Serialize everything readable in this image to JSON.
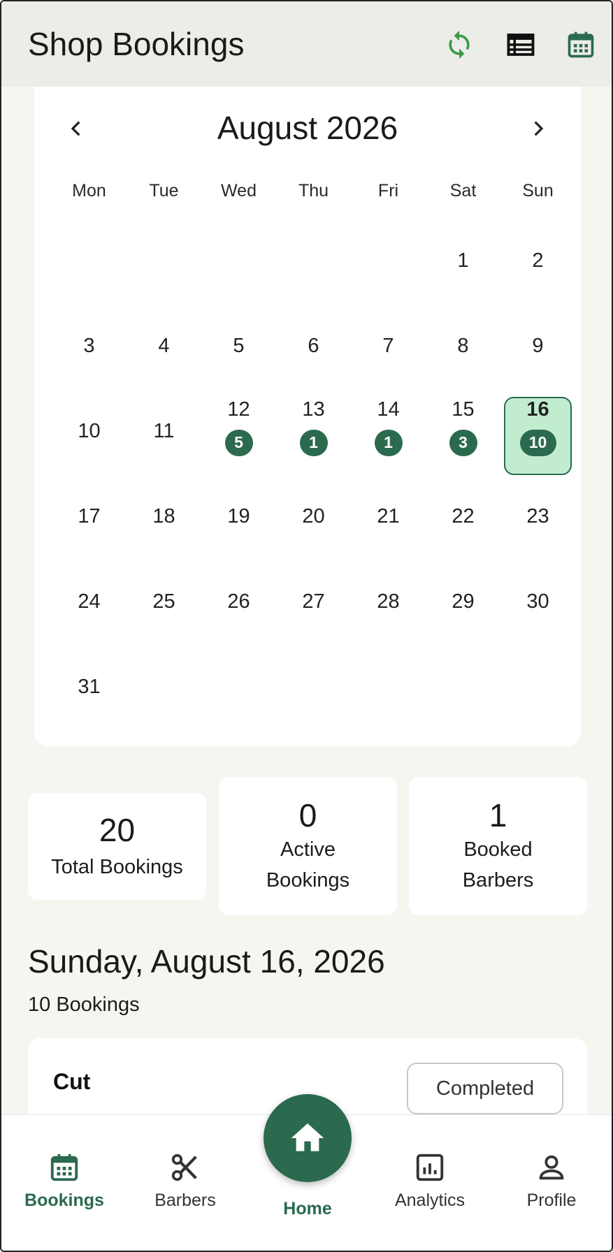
{
  "app_bar": {
    "title": "Shop Bookings",
    "icons": [
      "refresh-icon",
      "list-view-icon",
      "calendar-view-icon"
    ]
  },
  "calendar": {
    "month_label": "August 2026",
    "weekdays": [
      "Mon",
      "Tue",
      "Wed",
      "Thu",
      "Fri",
      "Sat",
      "Sun"
    ],
    "leading_blanks": 5,
    "days": [
      {
        "d": "1"
      },
      {
        "d": "2"
      },
      {
        "d": "3"
      },
      {
        "d": "4"
      },
      {
        "d": "5"
      },
      {
        "d": "6"
      },
      {
        "d": "7"
      },
      {
        "d": "8"
      },
      {
        "d": "9"
      },
      {
        "d": "10"
      },
      {
        "d": "11"
      },
      {
        "d": "12",
        "count": "5"
      },
      {
        "d": "13",
        "count": "1"
      },
      {
        "d": "14",
        "count": "1"
      },
      {
        "d": "15",
        "count": "3"
      },
      {
        "d": "16",
        "count": "10",
        "selected": true
      },
      {
        "d": "17"
      },
      {
        "d": "18"
      },
      {
        "d": "19"
      },
      {
        "d": "20"
      },
      {
        "d": "21"
      },
      {
        "d": "22"
      },
      {
        "d": "23"
      },
      {
        "d": "24"
      },
      {
        "d": "25"
      },
      {
        "d": "26"
      },
      {
        "d": "27"
      },
      {
        "d": "28"
      },
      {
        "d": "29"
      },
      {
        "d": "30"
      },
      {
        "d": "31"
      }
    ]
  },
  "stats": {
    "total": {
      "value": "20",
      "label": "Total Bookings"
    },
    "active": {
      "value": "0",
      "label_line1": "Active",
      "label_line2": "Bookings"
    },
    "barbers": {
      "value": "1",
      "label_line1": "Booked",
      "label_line2": "Barbers"
    }
  },
  "selected_date": {
    "heading": "Sunday, August 16, 2026",
    "count_label": "10 Bookings"
  },
  "booking": {
    "service": "Cut",
    "status": "Completed"
  },
  "bottom_nav": {
    "bookings": "Bookings",
    "barbers": "Barbers",
    "home": "Home",
    "analytics": "Analytics",
    "profile": "Profile"
  },
  "colors": {
    "accent": "#2b6a4e",
    "selected_day_bg": "#c2ecd0",
    "refresh_icon": "#3d9a4a",
    "background": "#f7f5f0",
    "app_bar": "#ecede8"
  }
}
